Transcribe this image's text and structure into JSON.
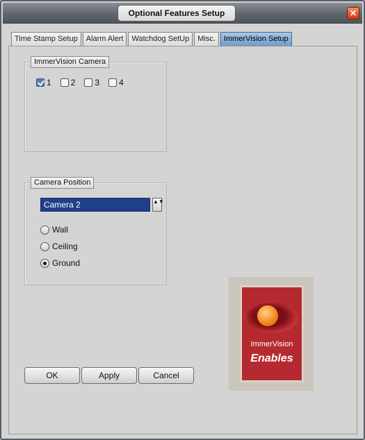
{
  "window": {
    "title": "Optional Features Setup",
    "close_glyph": "✕"
  },
  "tabs": [
    {
      "label": "Time Stamp Setup",
      "active": false
    },
    {
      "label": "Alarm Alert",
      "active": false
    },
    {
      "label": "Watchdog SetUp",
      "active": false
    },
    {
      "label": "Misc.",
      "active": false
    },
    {
      "label": "ImmerVision Setup",
      "active": true
    }
  ],
  "camera_group": {
    "label": "ImmerVision Camera",
    "checkboxes": [
      {
        "label": "1",
        "checked": true
      },
      {
        "label": "2",
        "checked": true
      },
      {
        "label": "3",
        "checked": false
      },
      {
        "label": "4",
        "checked": false
      }
    ]
  },
  "position_group": {
    "label": "Camera Position",
    "selected_camera": "Camera 2",
    "spin_glyph": "▲▼",
    "radios": [
      {
        "label": "Wall",
        "selected": false
      },
      {
        "label": "Ceiling",
        "selected": false
      },
      {
        "label": "Ground",
        "selected": true
      }
    ]
  },
  "buttons": {
    "ok": "OK",
    "apply": "Apply",
    "cancel": "Cancel"
  },
  "logo": {
    "name": "ImmerVision",
    "tagline": "Enables"
  },
  "colors": {
    "active_tab": "#6f9ccb",
    "select_bg": "#1f3f88",
    "logo_red": "#b52a30"
  }
}
